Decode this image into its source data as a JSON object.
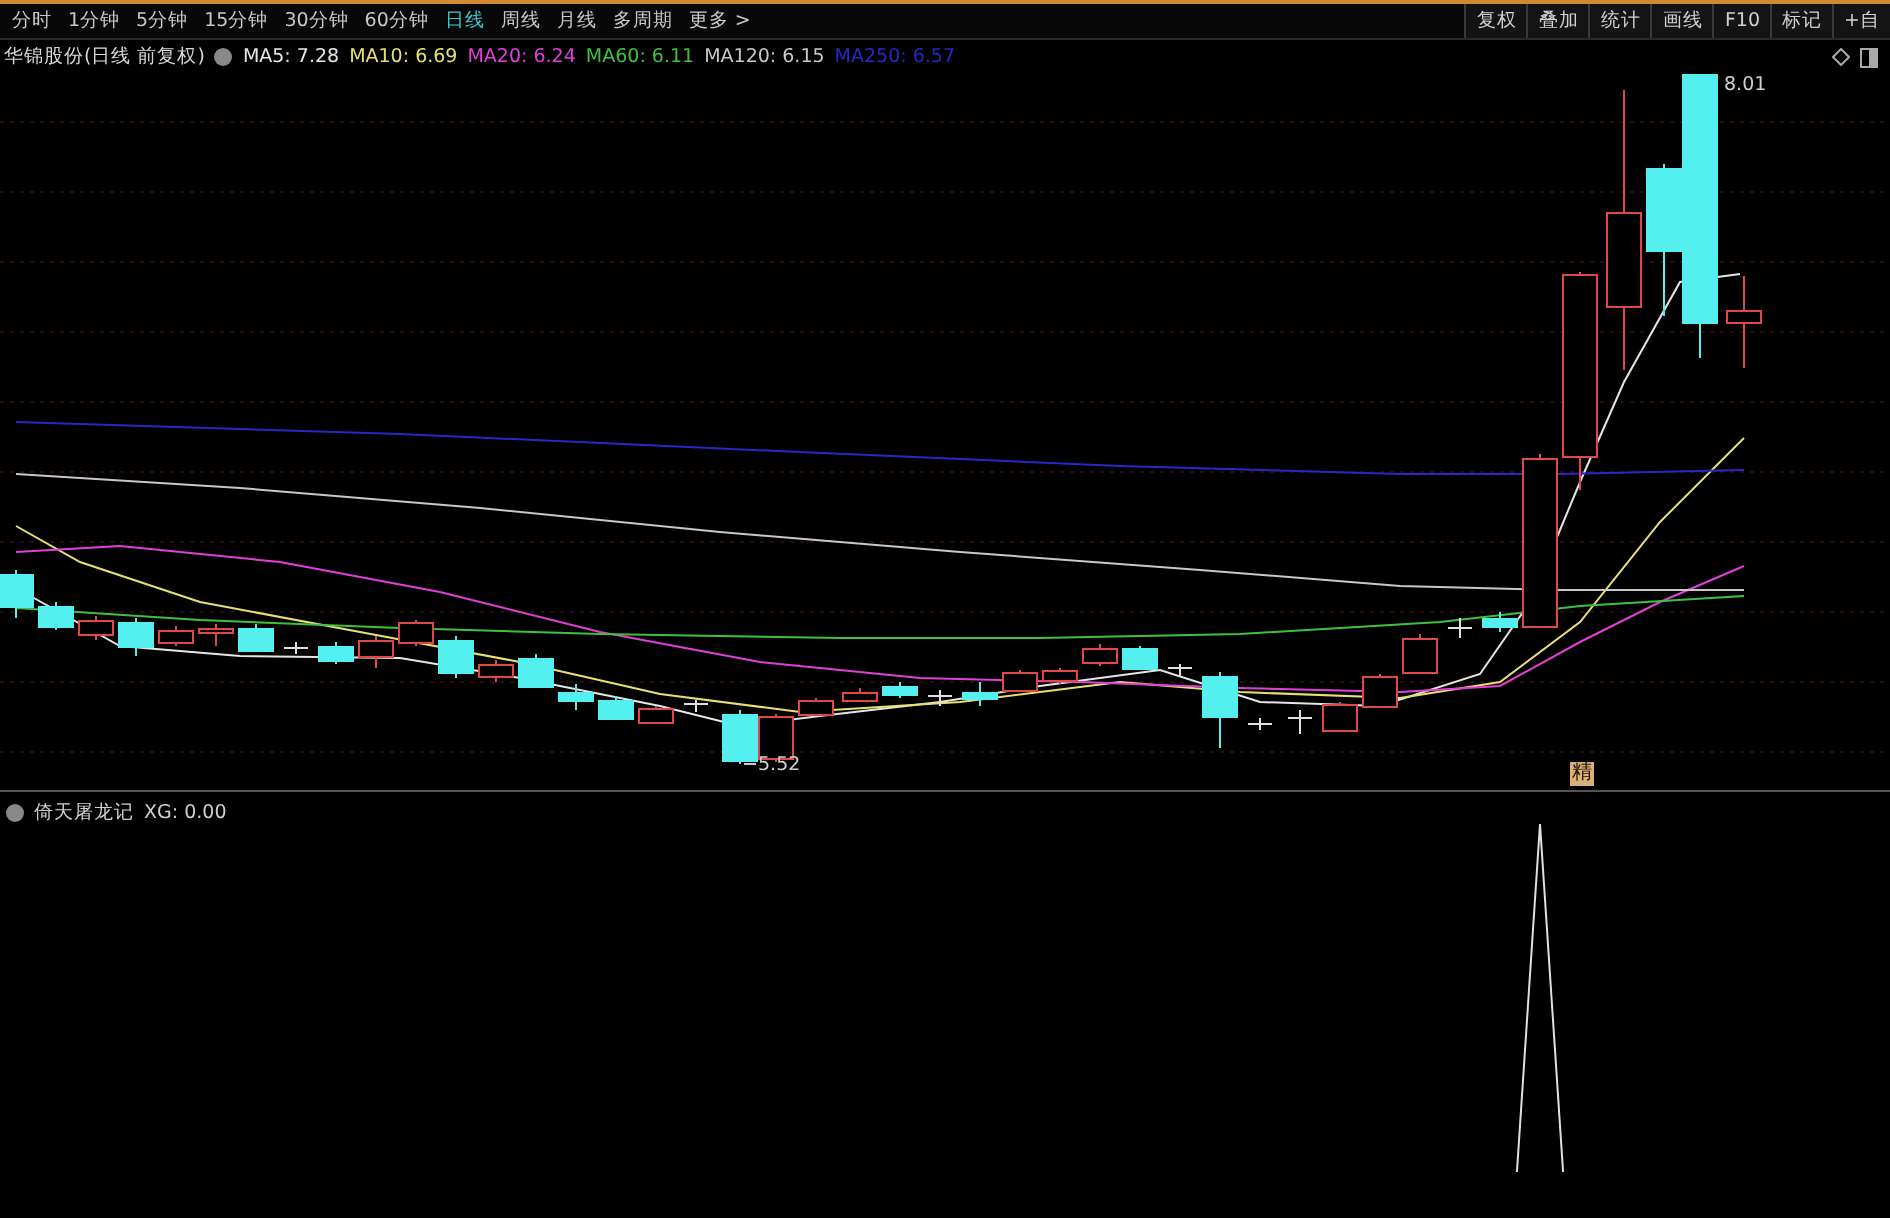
{
  "period_tabs": [
    {
      "label": "分时",
      "selected": false
    },
    {
      "label": "1分钟",
      "selected": false
    },
    {
      "label": "5分钟",
      "selected": false
    },
    {
      "label": "15分钟",
      "selected": false
    },
    {
      "label": "30分钟",
      "selected": false
    },
    {
      "label": "60分钟",
      "selected": false
    },
    {
      "label": "日线",
      "selected": true
    },
    {
      "label": "周线",
      "selected": false
    },
    {
      "label": "月线",
      "selected": false
    },
    {
      "label": "多周期",
      "selected": false
    },
    {
      "label": "更多 >",
      "selected": false
    }
  ],
  "toolbar_buttons": [
    "复权",
    "叠加",
    "统计",
    "画线",
    "F10",
    "标记",
    "+自"
  ],
  "info_bar": {
    "title": "华锦股份(日线 前复权)",
    "indicators": [
      {
        "label": "MA5: 7.28",
        "color": "#e6e6e6"
      },
      {
        "label": "MA10: 6.69",
        "color": "#e8e070"
      },
      {
        "label": "MA20: 6.24",
        "color": "#e040d8"
      },
      {
        "label": "MA60: 6.11",
        "color": "#40c040"
      },
      {
        "label": "MA120: 6.15",
        "color": "#c8c8c8"
      },
      {
        "label": "MA250: 6.57",
        "color": "#2828c8"
      }
    ]
  },
  "price_chart": {
    "high_label": "8.01",
    "low_label": "5.52",
    "signal_label": "精"
  },
  "indicator_panel": {
    "title": "倚天屠龙记",
    "reading": "XG: 0.00"
  }
}
